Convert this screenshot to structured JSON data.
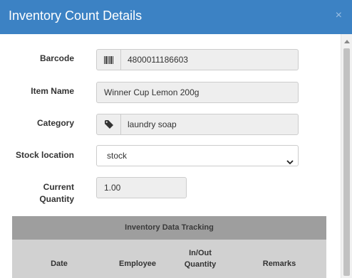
{
  "header": {
    "title": "Inventory Count Details",
    "close_label": "×"
  },
  "form": {
    "barcode": {
      "label": "Barcode",
      "value": "4800011186603",
      "icon": "barcode-icon"
    },
    "item_name": {
      "label": "Item Name",
      "value": "Winner Cup Lemon 200g"
    },
    "category": {
      "label": "Category",
      "value": "laundry soap",
      "icon": "tag-icon"
    },
    "stock_location": {
      "label": "Stock location",
      "value": "stock"
    },
    "current_quantity": {
      "label_line1": "Current",
      "label_line2": "Quantity",
      "value": "1.00"
    }
  },
  "table": {
    "title": "Inventory Data Tracking",
    "columns": {
      "date": "Date",
      "employee": "Employee",
      "inout_line1": "In/Out",
      "inout_line2": "Quantity",
      "remarks": "Remarks"
    }
  },
  "colors": {
    "header": "#3c82c4",
    "field_bg": "#eeeeee",
    "table_title": "#9e9e9e",
    "table_head": "#d1d1d1"
  }
}
